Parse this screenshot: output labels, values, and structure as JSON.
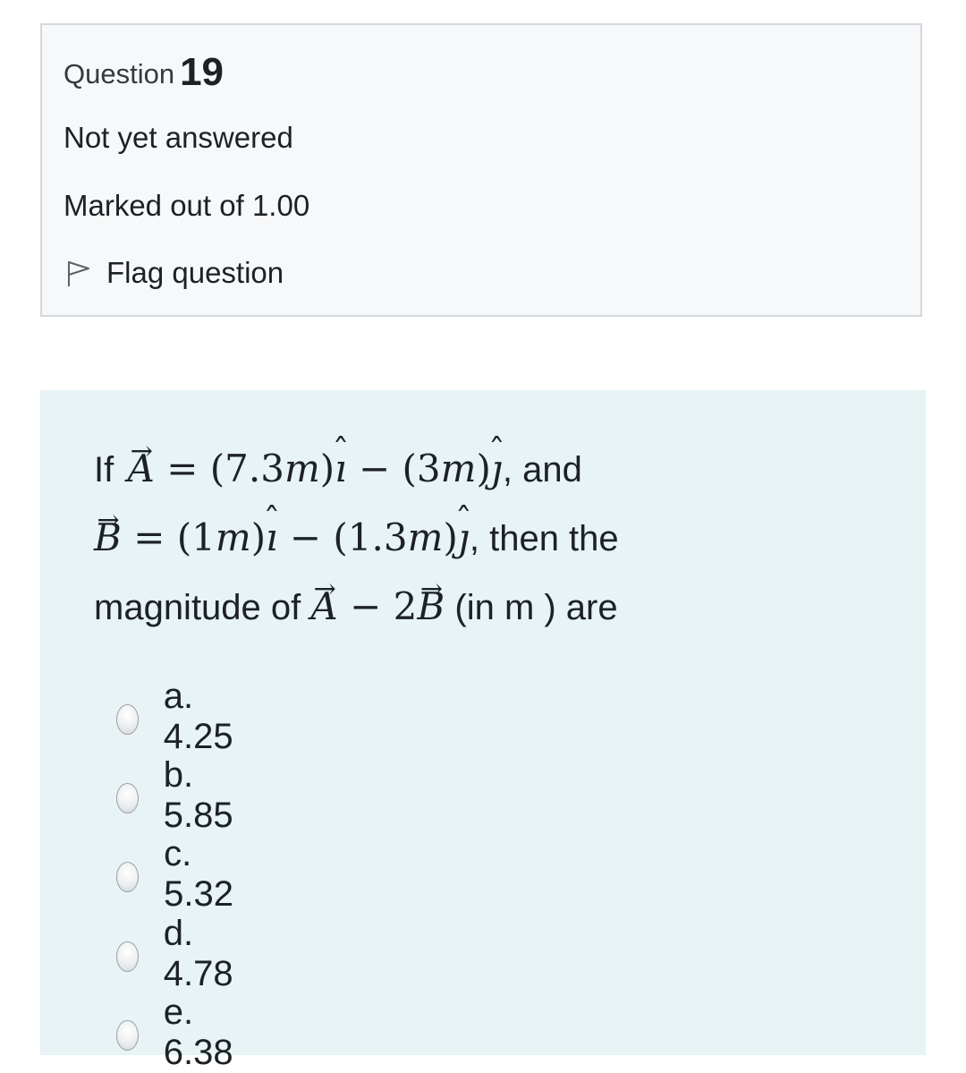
{
  "info": {
    "question_label": "Question",
    "question_number": "19",
    "state": "Not yet answered",
    "grade": "Marked out of 1.00",
    "flag_label": "Flag question"
  },
  "question": {
    "line1_prefix": "If",
    "line1_suffix": ", and",
    "line2_suffix": ", then the",
    "line3_prefix": "magnitude of",
    "line3_suffix": "(in m ) are"
  },
  "options": [
    {
      "label": "a. 4.25"
    },
    {
      "label": "b. 5.85"
    },
    {
      "label": "c. 5.32"
    },
    {
      "label": "d. 4.78"
    },
    {
      "label": "e. 6.38"
    }
  ],
  "colors": {
    "info_background": "#f7f8fa",
    "info_border": "#d3d8dd",
    "content_background": "#e7f3f5"
  }
}
